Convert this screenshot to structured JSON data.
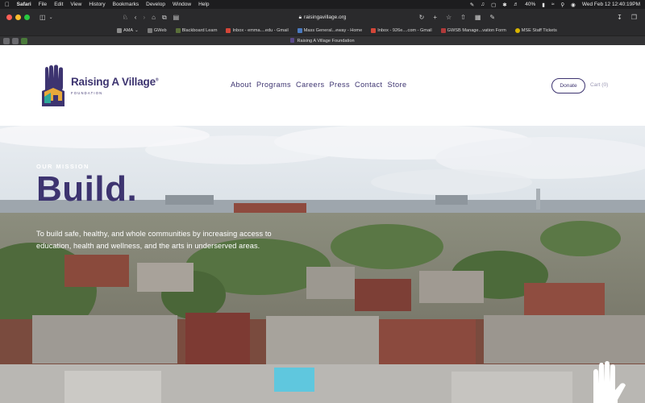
{
  "menubar": {
    "apple": "",
    "app_name": "Safari",
    "menus": [
      "File",
      "Edit",
      "View",
      "History",
      "Bookmarks",
      "Develop",
      "Window",
      "Help"
    ],
    "battery": "40%",
    "datetime": "Wed Feb 12  12:40:19PM"
  },
  "browser": {
    "url": "raisingavillage.org",
    "tab_title": "Raising A Village Foundation",
    "lock_icon": "lock-icon"
  },
  "bookmarks": [
    {
      "label": "AMA",
      "color": "#8a8a8a"
    },
    {
      "label": "GWeb",
      "color": "#7a7a7a"
    },
    {
      "label": "Blackboard Learn",
      "color": "#5a6f3a"
    },
    {
      "label": "Inbox - emma....edu - Gmail",
      "color": "#d44638"
    },
    {
      "label": "Mass General...eway - Home",
      "color": "#4a7abf"
    },
    {
      "label": "Inbox - 926e....com - Gmail",
      "color": "#d44638"
    },
    {
      "label": "GWSB Manage...vation Form",
      "color": "#b03a3a"
    },
    {
      "label": "MSE Staff Tickets",
      "color": "#d8b400"
    }
  ],
  "site": {
    "logo_text": "Raising A Village",
    "logo_registered": "®",
    "logo_sub": "FOUNDATION",
    "nav": [
      "About",
      "Programs",
      "Careers",
      "Press",
      "Contact",
      "Store"
    ],
    "donate": "Donate",
    "cart": "Cart (0)",
    "brand_color": "#3d3470"
  },
  "hero": {
    "eyebrow": "OUR MISSION",
    "headline": "Build.",
    "mission_line1": "To build safe, healthy, and whole communities by increasing access to",
    "mission_line2": "education, health and wellness, and the arts in underserved areas."
  }
}
